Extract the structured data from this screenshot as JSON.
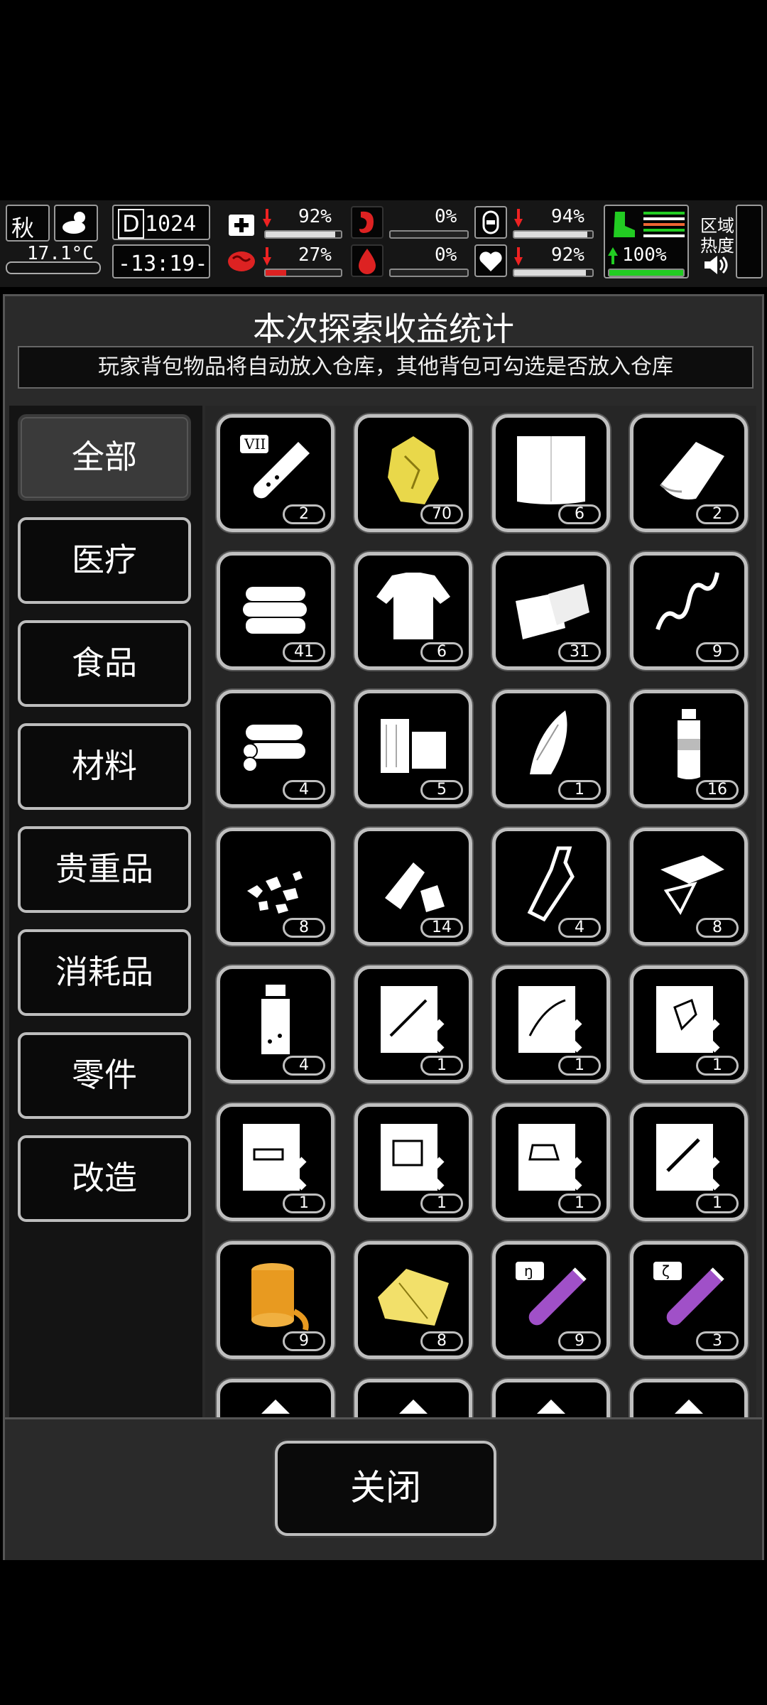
{
  "status": {
    "season": "秋",
    "day_icon": "D",
    "day": "1024",
    "temperature": "17.1°C",
    "time": "-13:19-",
    "health_pct": "92%",
    "hunger_pct": "0%",
    "armor_pct": "94%",
    "brain_pct": "27%",
    "thirst_pct": "0%",
    "mood_pct": "92%",
    "stamina_pct": "100%",
    "zone_heat_label1": "区域",
    "zone_heat_label2": "热度",
    "bars": {
      "health": 0.92,
      "hunger": 0.0,
      "armor": 0.94,
      "brain": 0.27,
      "thirst": 0.0,
      "mood": 0.92,
      "stamina": 1.0
    }
  },
  "panel": {
    "title": "本次探索收益统计",
    "subtitle": "玩家背包物品将自动放入仓库，其他背包可勾选是否放入仓库"
  },
  "categories": [
    "全部",
    "医疗",
    "食品",
    "材料",
    "贵重品",
    "消耗品",
    "零件",
    "改造"
  ],
  "active_category": "全部",
  "items": [
    {
      "icon": "vial-vii-icon",
      "count": "2"
    },
    {
      "icon": "gold-ore-icon",
      "count": "70"
    },
    {
      "icon": "cloth-sheet-icon",
      "count": "6"
    },
    {
      "icon": "towel-icon",
      "count": "2"
    },
    {
      "icon": "folded-clothes-icon",
      "count": "41"
    },
    {
      "icon": "torn-shirt-icon",
      "count": "6"
    },
    {
      "icon": "fabric-pieces-icon",
      "count": "31"
    },
    {
      "icon": "spring-icon",
      "count": "9"
    },
    {
      "icon": "logs-icon",
      "count": "4"
    },
    {
      "icon": "wood-planks-icon",
      "count": "5"
    },
    {
      "icon": "corn-icon",
      "count": "1"
    },
    {
      "icon": "water-bottle-icon",
      "count": "16"
    },
    {
      "icon": "rubble-icon",
      "count": "8"
    },
    {
      "icon": "crushed-bottle-icon",
      "count": "14"
    },
    {
      "icon": "glass-bottle-icon",
      "count": "4"
    },
    {
      "icon": "glass-shards-icon",
      "count": "8"
    },
    {
      "icon": "medicine-bottle-icon",
      "count": "4"
    },
    {
      "icon": "blueprint-rifle-icon",
      "count": "1"
    },
    {
      "icon": "blueprint-blade-icon",
      "count": "1"
    },
    {
      "icon": "blueprint-grip-icon",
      "count": "1"
    },
    {
      "icon": "blueprint-scope-icon",
      "count": "1"
    },
    {
      "icon": "blueprint-magazine-icon",
      "count": "1"
    },
    {
      "icon": "blueprint-armor-icon",
      "count": "1"
    },
    {
      "icon": "blueprint-barrel-icon",
      "count": "1"
    },
    {
      "icon": "tape-roll-icon",
      "count": "9"
    },
    {
      "icon": "gold-cloth-icon",
      "count": "8"
    },
    {
      "icon": "vial-purple-icon",
      "count": "9"
    },
    {
      "icon": "vial-purple-2-icon",
      "count": "3"
    },
    {
      "icon": "partial-item-icon",
      "count": ""
    },
    {
      "icon": "partial-item-icon",
      "count": ""
    },
    {
      "icon": "partial-item-icon",
      "count": ""
    },
    {
      "icon": "partial-item-icon",
      "count": ""
    }
  ],
  "close_label": "关闭"
}
